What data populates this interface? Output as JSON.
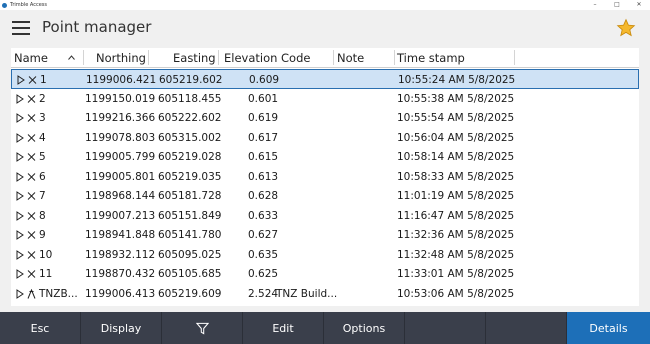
{
  "window": {
    "title": "Trimble Access",
    "controls": [
      "–",
      "□",
      "✕"
    ]
  },
  "header": {
    "title": "Point manager",
    "menu_icon": "hamburger-icon",
    "favorite_icon": "star-icon",
    "favorite_color": "#f5b82e"
  },
  "columns": [
    {
      "label": "Name",
      "sort": "ascending"
    },
    {
      "label": "Northing"
    },
    {
      "label": "Easting"
    },
    {
      "label": "Elevation"
    },
    {
      "label": "Code"
    },
    {
      "label": "Note"
    },
    {
      "label": "Time stamp"
    }
  ],
  "rows": [
    {
      "symbol": "cross",
      "name": "1",
      "northing": "1199006.421",
      "easting": "605219.602",
      "elevation": "0.609",
      "code": "",
      "note": "",
      "time": "10:55:24 AM 5/8/2025",
      "selected": true
    },
    {
      "symbol": "cross",
      "name": "2",
      "northing": "1199150.019",
      "easting": "605118.455",
      "elevation": "0.601",
      "code": "",
      "note": "",
      "time": "10:55:38 AM 5/8/2025"
    },
    {
      "symbol": "cross",
      "name": "3",
      "northing": "1199216.366",
      "easting": "605222.602",
      "elevation": "0.619",
      "code": "",
      "note": "",
      "time": "10:55:54 AM 5/8/2025"
    },
    {
      "symbol": "cross",
      "name": "4",
      "northing": "1199078.803",
      "easting": "605315.002",
      "elevation": "0.617",
      "code": "",
      "note": "",
      "time": "10:56:04 AM 5/8/2025"
    },
    {
      "symbol": "cross",
      "name": "5",
      "northing": "1199005.799",
      "easting": "605219.028",
      "elevation": "0.615",
      "code": "",
      "note": "",
      "time": "10:58:14 AM 5/8/2025"
    },
    {
      "symbol": "cross",
      "name": "6",
      "northing": "1199005.801",
      "easting": "605219.035",
      "elevation": "0.613",
      "code": "",
      "note": "",
      "time": "10:58:33 AM 5/8/2025"
    },
    {
      "symbol": "cross",
      "name": "7",
      "northing": "1198968.144",
      "easting": "605181.728",
      "elevation": "0.628",
      "code": "",
      "note": "",
      "time": "11:01:19 AM 5/8/2025"
    },
    {
      "symbol": "cross",
      "name": "8",
      "northing": "1199007.213",
      "easting": "605151.849",
      "elevation": "0.633",
      "code": "",
      "note": "",
      "time": "11:16:47 AM 5/8/2025"
    },
    {
      "symbol": "cross",
      "name": "9",
      "northing": "1198941.848",
      "easting": "605141.780",
      "elevation": "0.627",
      "code": "",
      "note": "",
      "time": "11:32:36 AM 5/8/2025"
    },
    {
      "symbol": "cross",
      "name": "10",
      "northing": "1198932.112",
      "easting": "605095.025",
      "elevation": "0.635",
      "code": "",
      "note": "",
      "time": "11:32:48 AM 5/8/2025"
    },
    {
      "symbol": "cross",
      "name": "11",
      "northing": "1198870.432",
      "easting": "605105.685",
      "elevation": "0.625",
      "code": "",
      "note": "",
      "time": "11:33:01 AM 5/8/2025"
    },
    {
      "symbol": "station",
      "name": "TNZB...",
      "northing": "1199006.413",
      "easting": "605219.609",
      "elevation": "2.524",
      "code": "TNZ Build...",
      "note": "",
      "time": "10:53:06 AM 5/8/2025"
    }
  ],
  "toolbar": {
    "buttons": [
      "Esc",
      "Display",
      "",
      "Edit",
      "Options",
      "",
      "",
      "Details"
    ],
    "filter_icon": "filter-icon"
  },
  "colors": {
    "toolbar": "#3a3f4b",
    "primary_button": "#1d6fb8",
    "selection": "#cfe2f5",
    "selection_border": "#2a6fb0"
  }
}
